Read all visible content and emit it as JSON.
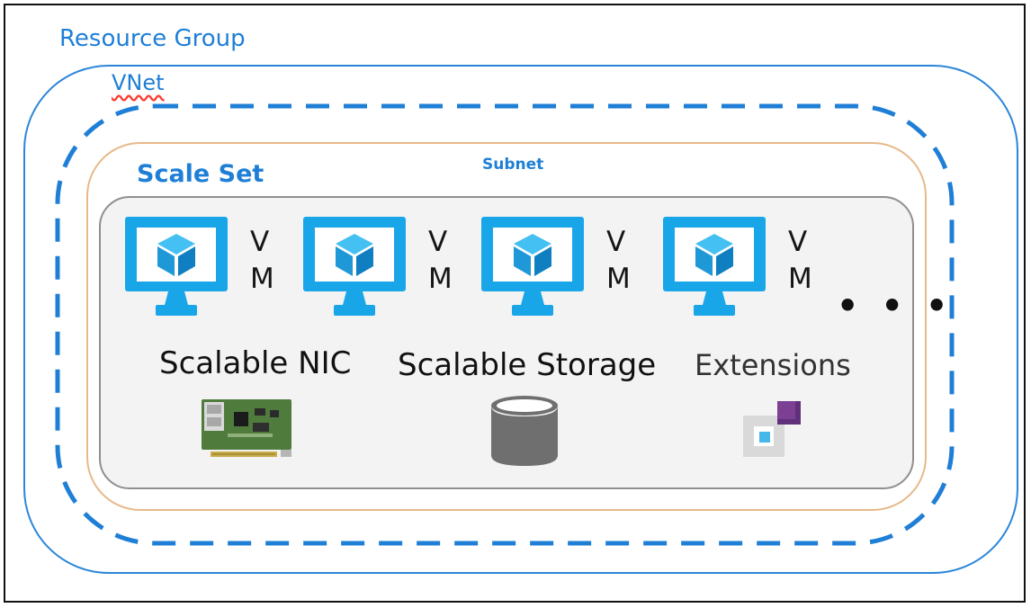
{
  "diagram": {
    "labels": {
      "resource_group": "Resource Group",
      "vnet": "VNet",
      "subnet": "Subnet",
      "scale_set": "Scale Set",
      "ellipsis": "• • •"
    },
    "vms": [
      {
        "v": "V",
        "m": "M"
      },
      {
        "v": "V",
        "m": "M"
      },
      {
        "v": "V",
        "m": "M"
      },
      {
        "v": "V",
        "m": "M"
      }
    ],
    "features": {
      "nic": "Scalable NIC",
      "storage": "Scalable Storage",
      "extensions": "Extensions"
    },
    "colors": {
      "blue": "#1f7fd6",
      "vm_blue": "#19a6e8",
      "subnet_border": "#e7b98a",
      "scaleset_fill": "#f3f3f3",
      "storage_gray": "#6f6f6f",
      "extension_purple": "#7b3f93",
      "extension_cyan": "#46b7e8"
    },
    "icons": [
      "vm-monitor-icon",
      "network-card-icon",
      "storage-cylinder-icon",
      "extensions-icon"
    ]
  }
}
